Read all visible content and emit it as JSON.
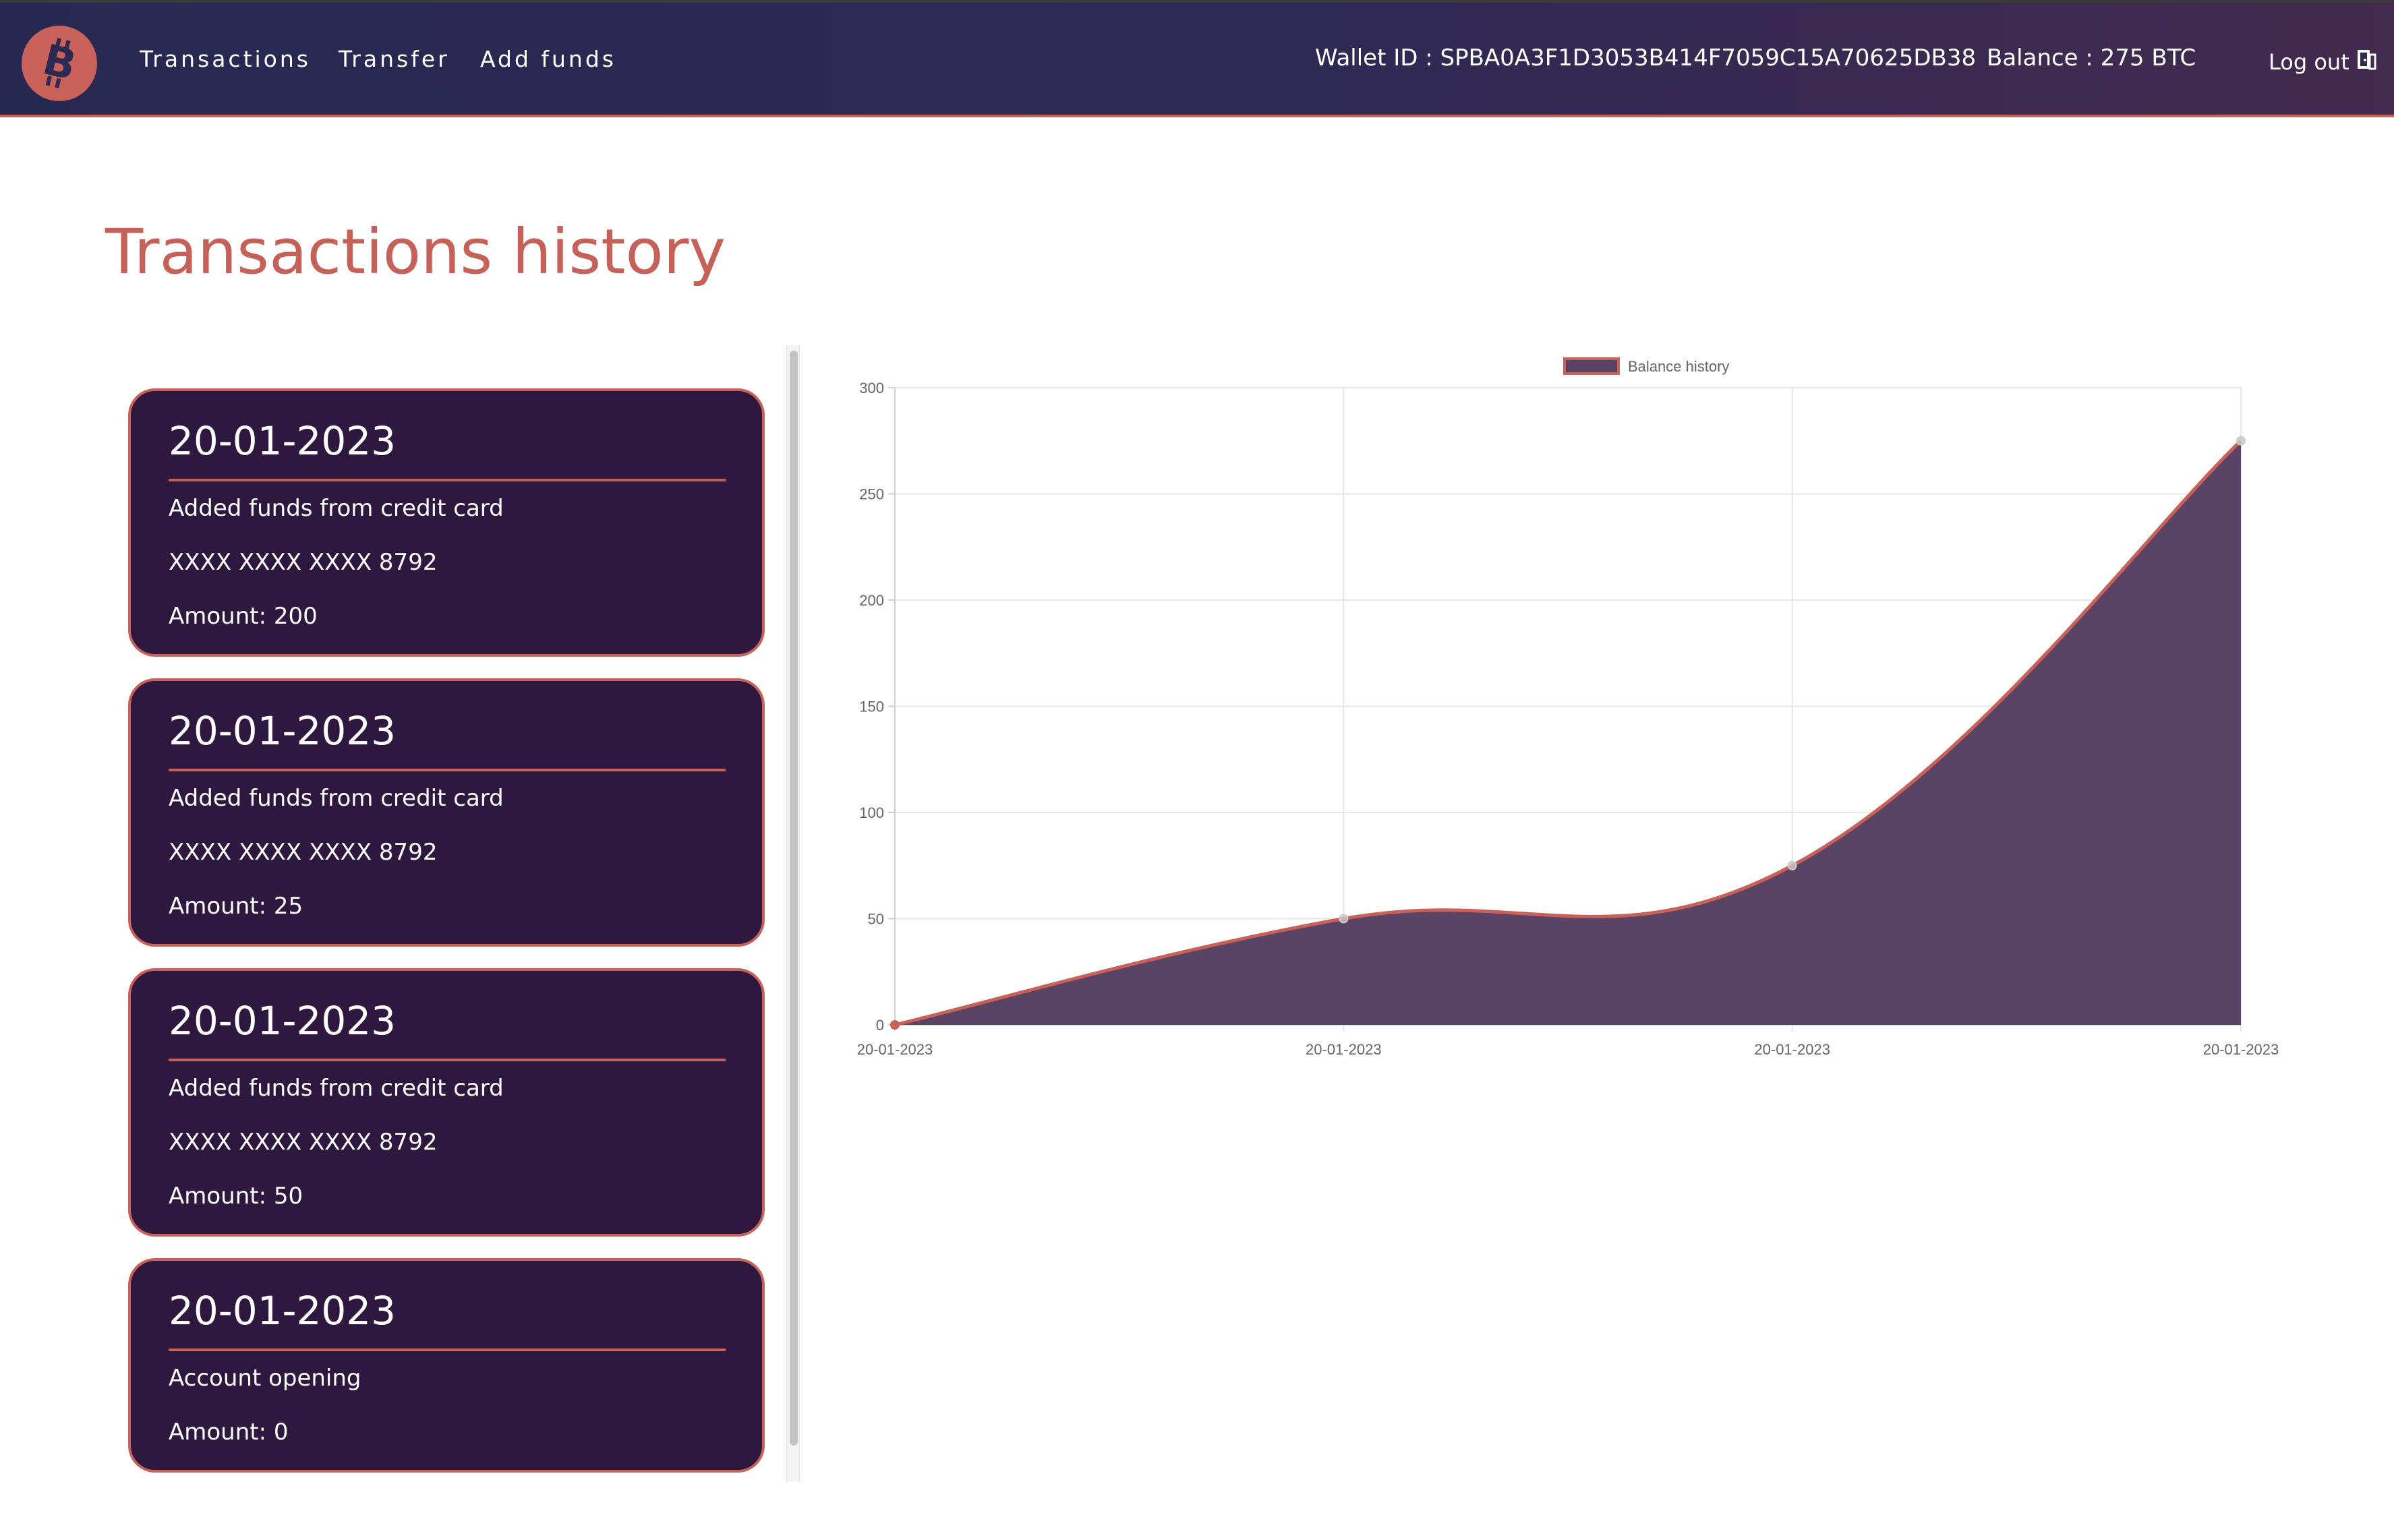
{
  "nav": {
    "links": [
      "Transactions",
      "Transfer",
      "Add funds"
    ],
    "wallet": "Wallet ID : SPBA0A3F1D3053B414F7059C15A70625DB38",
    "balance": "Balance : 275 BTC",
    "logout": "Log out",
    "logo_icon": "bitcoin-icon",
    "logout_icon": "door-exit-icon"
  },
  "page_title": "Transactions history",
  "transactions": [
    {
      "date": "20-01-2023",
      "description": "Added funds from credit card",
      "card": "XXXX XXXX XXXX 8792",
      "amount": "Amount: 200"
    },
    {
      "date": "20-01-2023",
      "description": "Added funds from credit card",
      "card": "XXXX XXXX XXXX 8792",
      "amount": "Amount: 25"
    },
    {
      "date": "20-01-2023",
      "description": "Added funds from credit card",
      "card": "XXXX XXXX XXXX 8792",
      "amount": "Amount: 50"
    },
    {
      "date": "20-01-2023",
      "description": "Account opening",
      "amount": "Amount: 0"
    }
  ],
  "colors": {
    "accent": "#c8615a",
    "card_bg": "#2e1840",
    "area_fill": "#5a4465",
    "nav_bg": "#2c2853"
  },
  "chart_data": {
    "type": "area",
    "x": [
      "20-01-2023",
      "20-01-2023",
      "20-01-2023",
      "20-01-2023"
    ],
    "series": [
      {
        "name": "Balance history",
        "values": [
          0,
          50,
          75,
          275
        ]
      }
    ],
    "ylim": [
      0,
      300
    ],
    "yticks": [
      0,
      50,
      100,
      150,
      200,
      250,
      300
    ],
    "grid": true,
    "legend": "top-center",
    "smooth": true
  }
}
